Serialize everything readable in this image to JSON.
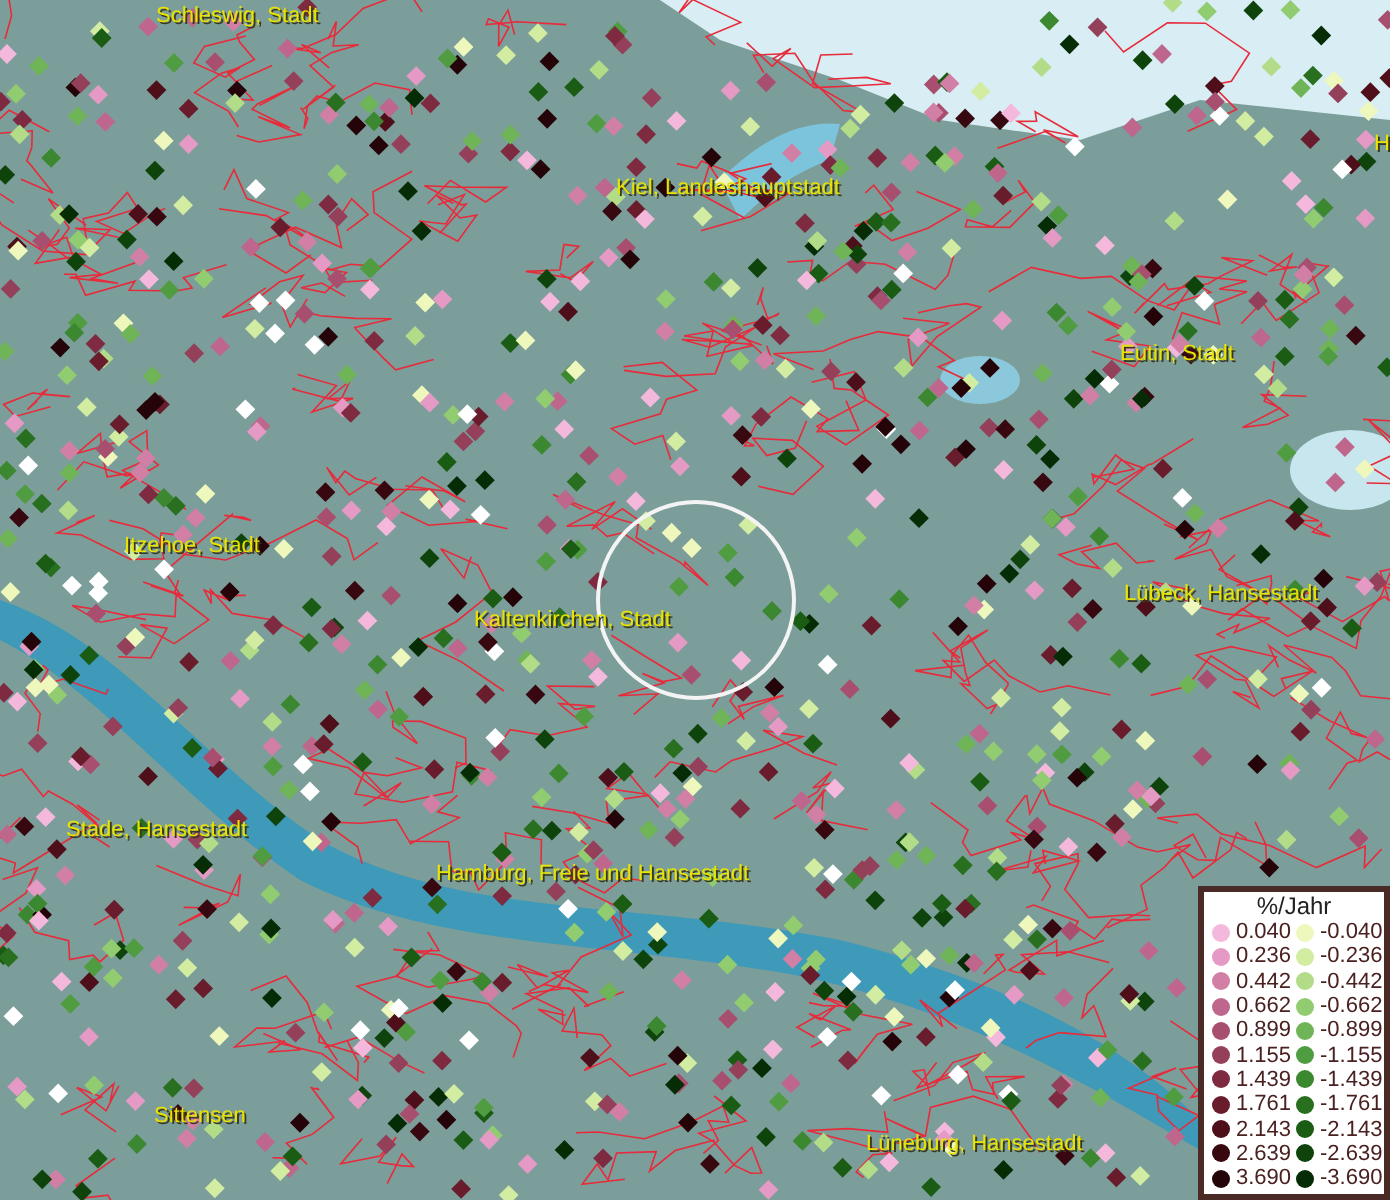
{
  "map_labels": [
    {
      "text": "Schleswig, Stadt"
    },
    {
      "text": "Kiel, Landeshauptstadt"
    },
    {
      "text": "H"
    },
    {
      "text": "Eutin, Stadt"
    },
    {
      "text": "Itzehoe, Stadt"
    },
    {
      "text": "Lübeck, Hansestadt"
    },
    {
      "text": "Kaltenkirchen, Stadt"
    },
    {
      "text": "Stade, Hansestadt"
    },
    {
      "text": "Hamburg, Freie und Hansestadt"
    },
    {
      "text": "Sittensen"
    },
    {
      "text": "Lüneburg, Hansestadt"
    }
  ],
  "legend": {
    "title": "%/Jahr",
    "items": [
      {
        "label": "0.040",
        "color": "#f4b8dc"
      },
      {
        "label": "-0.040",
        "color": "#eef8bc"
      },
      {
        "label": "0.236",
        "color": "#e49ac4"
      },
      {
        "label": "-0.236",
        "color": "#d2eca2"
      },
      {
        "label": "0.442",
        "color": "#d27fa6"
      },
      {
        "label": "-0.442",
        "color": "#b2dc88"
      },
      {
        "label": "0.662",
        "color": "#be668c"
      },
      {
        "label": "-0.662",
        "color": "#92cc70"
      },
      {
        "label": "0.899",
        "color": "#a84f70"
      },
      {
        "label": "-0.899",
        "color": "#70b458"
      },
      {
        "label": "1.155",
        "color": "#94405a"
      },
      {
        "label": "-1.155",
        "color": "#509c40"
      },
      {
        "label": "1.439",
        "color": "#7e2a40"
      },
      {
        "label": "-1.439",
        "color": "#3c8830"
      },
      {
        "label": "1.761",
        "color": "#681c2c"
      },
      {
        "label": "-1.761",
        "color": "#287020"
      },
      {
        "label": "2.143",
        "color": "#4e0e1a"
      },
      {
        "label": "-2.143",
        "color": "#1a5c14"
      },
      {
        "label": "2.639",
        "color": "#380810"
      },
      {
        "label": "-2.639",
        "color": "#0e440c"
      },
      {
        "label": "3.690",
        "color": "#240408"
      },
      {
        "label": "-3.690",
        "color": "#062c06"
      }
    ]
  }
}
